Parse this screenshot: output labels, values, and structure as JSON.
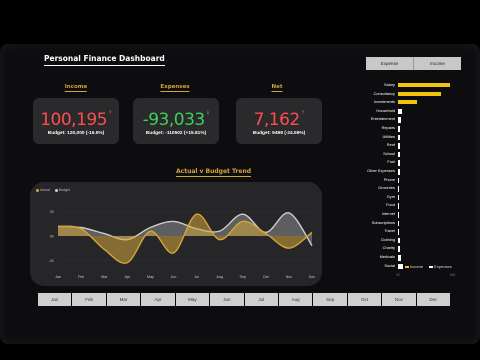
{
  "header": {
    "title": "Personal Finance Dashboard"
  },
  "toggle": {
    "expense_label": "Expense",
    "income_label": "Income"
  },
  "kpis": [
    {
      "label": "Income",
      "value": "100,195",
      "arrow": "↑",
      "color": "#ff4d4d",
      "budget": "Budget: 120,000 (-16.5%)"
    },
    {
      "label": "Expenses",
      "value": "-93,033",
      "arrow": "↓",
      "color": "#3ecf5a",
      "budget": "Budget: -110502 (+15.81%)"
    },
    {
      "label": "Net",
      "value": "7,162",
      "arrow": "↑",
      "color": "#ff4d4d",
      "budget": "Budget: 9498 (-24.59%)"
    }
  ],
  "trend": {
    "title": "Actual v Budget Trend",
    "legend": [
      {
        "name": "Actual",
        "color": "#d3a53a"
      },
      {
        "name": "Budget",
        "color": "#cccccc"
      }
    ],
    "y_tick_labels": [
      "2K",
      "0K",
      "-2K"
    ],
    "months": [
      "Jan",
      "Feb",
      "Mar",
      "Apr",
      "May",
      "Jun",
      "Jul",
      "Aug",
      "Sep",
      "Oct",
      "Nov",
      "Dec"
    ]
  },
  "chart_data": {
    "type": "area",
    "categories": [
      "Jan",
      "Feb",
      "Mar",
      "Apr",
      "May",
      "Jun",
      "Jul",
      "Aug",
      "Sep",
      "Oct",
      "Nov",
      "Dec"
    ],
    "series": [
      {
        "name": "Actual",
        "values": [
          800,
          600,
          -1100,
          -2200,
          400,
          -1400,
          1800,
          -300,
          1200,
          200,
          -1000,
          300
        ]
      },
      {
        "name": "Budget",
        "values": [
          800,
          700,
          200,
          -300,
          700,
          1200,
          600,
          400,
          1800,
          300,
          1900,
          -800
        ]
      }
    ],
    "ylim": [
      -2800,
      2800
    ],
    "grid": true,
    "legend_position": "top-left"
  },
  "expense_breakdown": {
    "legend": [
      {
        "name": "Income",
        "color": "#f2c40f"
      },
      {
        "name": "Expenses",
        "color": "#ffffff"
      }
    ],
    "axis_labels": [
      "0K",
      "50K"
    ],
    "categories": [
      {
        "name": "Salary",
        "value": 48000,
        "kind": "income"
      },
      {
        "name": "Consultancy",
        "value": 40000,
        "kind": "income"
      },
      {
        "name": "Investments",
        "value": 18000,
        "kind": "income"
      },
      {
        "name": "Household",
        "value": 3500,
        "kind": "expense"
      },
      {
        "name": "Entertainment",
        "value": 2500,
        "kind": "expense"
      },
      {
        "name": "Repairs",
        "value": 2200,
        "kind": "expense"
      },
      {
        "name": "Utilities",
        "value": 2000,
        "kind": "expense"
      },
      {
        "name": "Rent",
        "value": 1800,
        "kind": "expense"
      },
      {
        "name": "School",
        "value": 1700,
        "kind": "expense"
      },
      {
        "name": "Fuel",
        "value": 1500,
        "kind": "expense"
      },
      {
        "name": "Other Expenses",
        "value": 1400,
        "kind": "expense"
      },
      {
        "name": "Phone",
        "value": 1300,
        "kind": "expense"
      },
      {
        "name": "Groceries",
        "value": 1200,
        "kind": "expense"
      },
      {
        "name": "Gym",
        "value": 1100,
        "kind": "expense"
      },
      {
        "name": "Food",
        "value": 1000,
        "kind": "expense"
      },
      {
        "name": "Internet",
        "value": 1000,
        "kind": "expense"
      },
      {
        "name": "Subscriptions",
        "value": 900,
        "kind": "expense"
      },
      {
        "name": "Travel",
        "value": 900,
        "kind": "expense"
      },
      {
        "name": "Clothing",
        "value": 1700,
        "kind": "expense"
      },
      {
        "name": "Charity",
        "value": 1900,
        "kind": "expense"
      },
      {
        "name": "Medicals",
        "value": 3200,
        "kind": "expense"
      },
      {
        "name": "Social",
        "value": 4500,
        "kind": "expense"
      }
    ]
  },
  "month_slicer": [
    "Jan",
    "Feb",
    "Mar",
    "Apr",
    "May",
    "Jun",
    "Jul",
    "Aug",
    "Sep",
    "Oct",
    "Nov",
    "Dec"
  ]
}
